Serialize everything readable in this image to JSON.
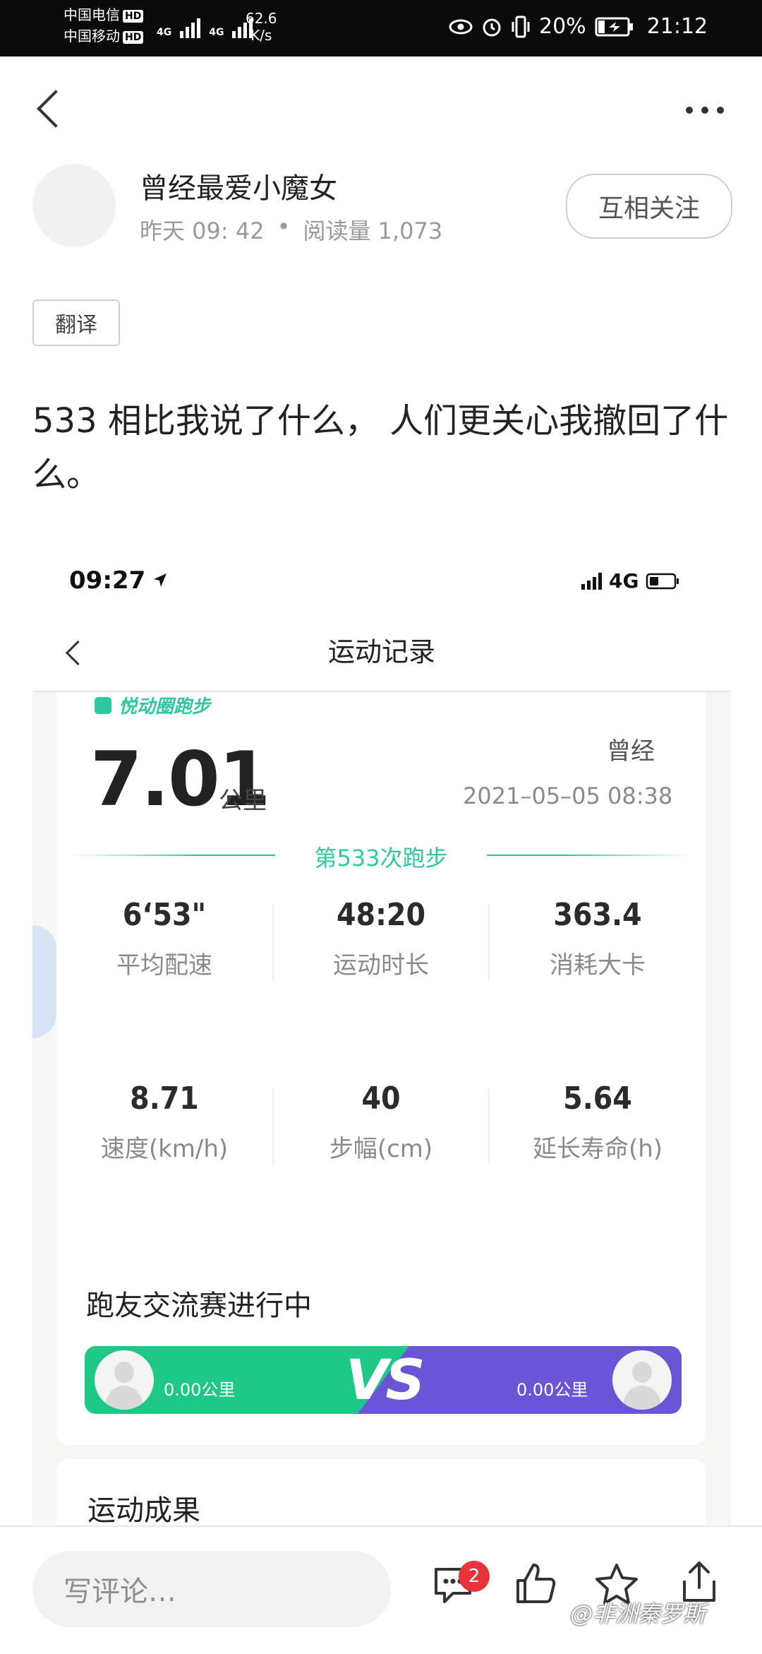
{
  "status_bar": {
    "carrier1": "中国电信",
    "carrier2": "中国移动",
    "hd": "HD",
    "net1": "4G",
    "net2": "4G",
    "speed_value": "62.6",
    "speed_unit": "K/s",
    "battery": "20%",
    "time": "21:12"
  },
  "post": {
    "author": "曾经最爱小魔女",
    "time": "昨天 09: 42",
    "dot": "•",
    "reads": "阅读量 1,073",
    "follow_label": "互相关注",
    "translate_label": "翻译",
    "content": "533 相比我说了什么， 人们更关心我撤回了什么。"
  },
  "shot": {
    "status_time": "09:27",
    "net": "4G",
    "nav_title": "运动记录",
    "brand": "悦动圈跑步",
    "user": "曾经",
    "distance": "7.01",
    "distance_unit": "公里",
    "datetime": "2021–05–05 08:38",
    "run_count": "第533次跑步",
    "metrics": [
      {
        "value": "6‘53\"",
        "label": "平均配速"
      },
      {
        "value": "48:20",
        "label": "运动时长"
      },
      {
        "value": "363.4",
        "label": "消耗大卡"
      },
      {
        "value": "8.71",
        "label": "速度(km/h)"
      },
      {
        "value": "40",
        "label": "步幅(cm)"
      },
      {
        "value": "5.64",
        "label": "延长寿命(h)"
      }
    ],
    "challenge_title": "跑友交流赛进行中",
    "left_km": "0.00公里",
    "right_km": "0.00公里",
    "vs": "VS",
    "results_title": "运动成果",
    "colors": {
      "green": "#1ec887",
      "purple": "#6a55d6",
      "accent": "#2ec7a0"
    }
  },
  "bottom": {
    "comment_placeholder": "写评论…",
    "badge": "2",
    "watermark": "@非洲秦罗斯"
  }
}
